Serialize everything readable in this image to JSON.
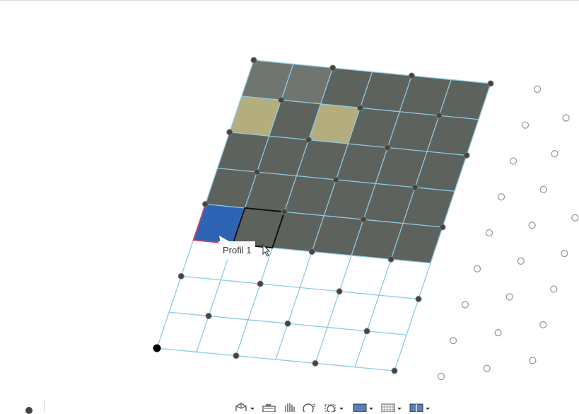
{
  "tooltip": {
    "label": "Profil 1"
  },
  "colors": {
    "surface_dark": "#5e625d",
    "surface_highlight": "#b4ae7e",
    "surface_selected": "#2f64b5",
    "grid_line": "#8ccbe6",
    "grid_node": "#444444",
    "origin_node": "#000000",
    "ghost_node": "#9a9a9a",
    "selection_edge": "#e23a5a"
  },
  "toolbar": {
    "buttons": [
      {
        "icon": "view-cube-icon"
      },
      {
        "icon": "camera-icon"
      },
      {
        "icon": "pan-hand-icon"
      },
      {
        "icon": "zoom-icon"
      },
      {
        "icon": "zoom-window-icon"
      },
      {
        "icon": "display-style-icon"
      },
      {
        "icon": "grid-display-icon"
      },
      {
        "icon": "viewport-layout-icon"
      }
    ]
  }
}
